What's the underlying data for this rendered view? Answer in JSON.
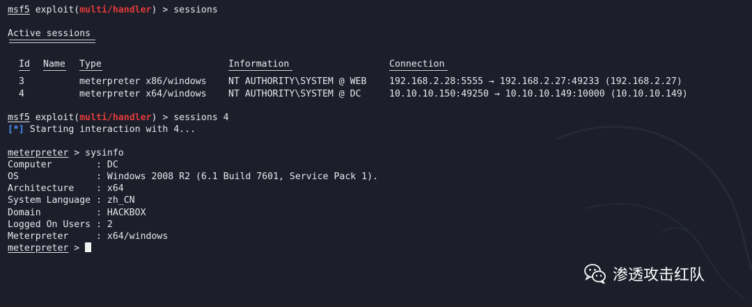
{
  "prompt_cmd1": {
    "msf": "msf5",
    "exploit_prefix": " exploit(",
    "module": "multi/handler",
    "suffix": ") > sessions"
  },
  "active_sessions_title": "Active sessions",
  "table": {
    "headers": {
      "id": "Id",
      "name": "Name",
      "type": "Type",
      "information": "Information",
      "connection": "Connection"
    },
    "rows": [
      {
        "id": "3",
        "name": "",
        "type": "meterpreter x86/windows",
        "information": "NT AUTHORITY\\SYSTEM @ WEB",
        "connection": "192.168.2.28:5555 → 192.168.2.27:49233 (192.168.2.27)"
      },
      {
        "id": "4",
        "name": "",
        "type": "meterpreter x64/windows",
        "information": "NT AUTHORITY\\SYSTEM @ DC",
        "connection": "10.10.10.150:49250 → 10.10.10.149:10000 (10.10.10.149)"
      }
    ]
  },
  "prompt_cmd2": {
    "msf": "msf5",
    "exploit_prefix": " exploit(",
    "module": "multi/handler",
    "suffix": ") > sessions 4"
  },
  "status_line": {
    "tag": "[*]",
    "text": " Starting interaction with 4..."
  },
  "meterpreter_cmd": {
    "prompt": "meterpreter",
    "suffix": " > sysinfo"
  },
  "sysinfo": [
    {
      "key": "Computer        ",
      "value": ": DC"
    },
    {
      "key": "OS              ",
      "value": ": Windows 2008 R2 (6.1 Build 7601, Service Pack 1)."
    },
    {
      "key": "Architecture    ",
      "value": ": x64"
    },
    {
      "key": "System Language ",
      "value": ": zh_CN"
    },
    {
      "key": "Domain          ",
      "value": ": HACKBOX"
    },
    {
      "key": "Logged On Users ",
      "value": ": 2"
    },
    {
      "key": "Meterpreter     ",
      "value": ": x64/windows"
    }
  ],
  "final_prompt": {
    "prompt": "meterpreter",
    "suffix": " > "
  },
  "watermark": {
    "text": "渗透攻击红队",
    "icon": "wechat-icon"
  },
  "colors": {
    "background": "#1c1f2a",
    "text": "#e6e8ee",
    "red": "#e23a3a",
    "blue": "#4c8df6"
  }
}
